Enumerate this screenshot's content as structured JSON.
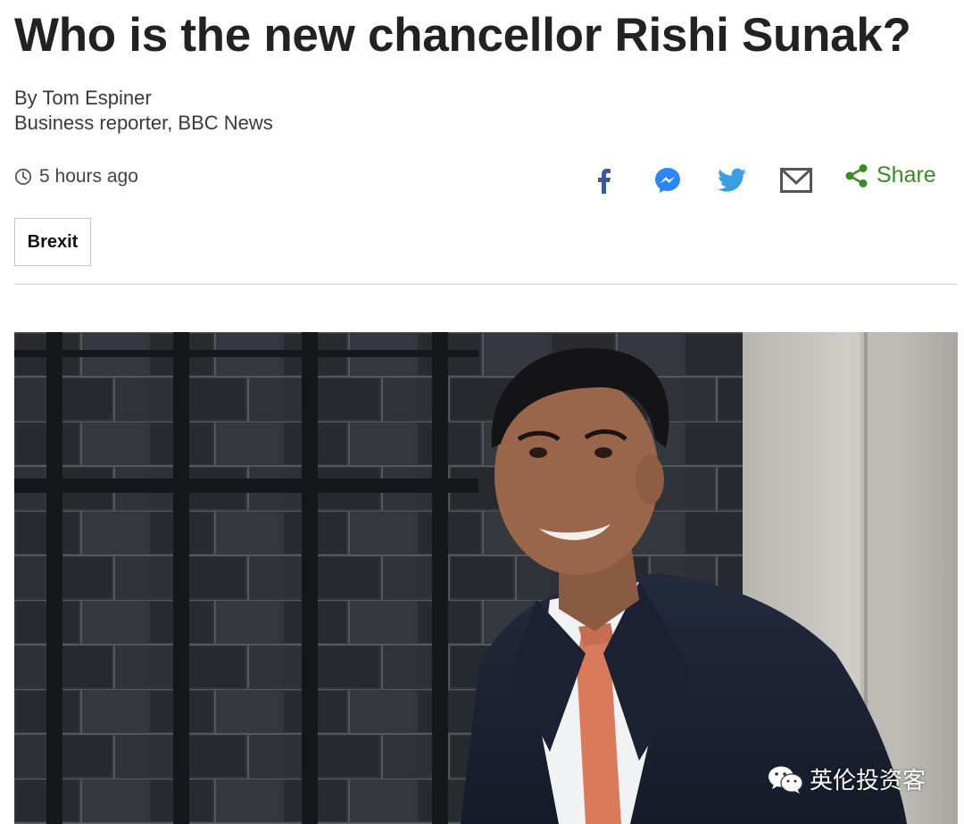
{
  "article": {
    "headline": "Who is the new chancellor Rishi Sunak?",
    "byline": {
      "author": "By Tom Espiner",
      "role": "Business reporter, BBC News"
    },
    "timestamp": "5 hours ago",
    "tag": "Brexit"
  },
  "share": {
    "label": "Share",
    "icons": [
      "facebook-icon",
      "messenger-icon",
      "twitter-icon",
      "email-icon",
      "share-icon"
    ],
    "colors": {
      "facebook": "#3b5998",
      "messenger": "#2c87f5",
      "twitter": "#3a9fe0",
      "email": "#555555",
      "share": "#3c8a24"
    }
  },
  "photo": {
    "watermark": "英伦投资客"
  }
}
